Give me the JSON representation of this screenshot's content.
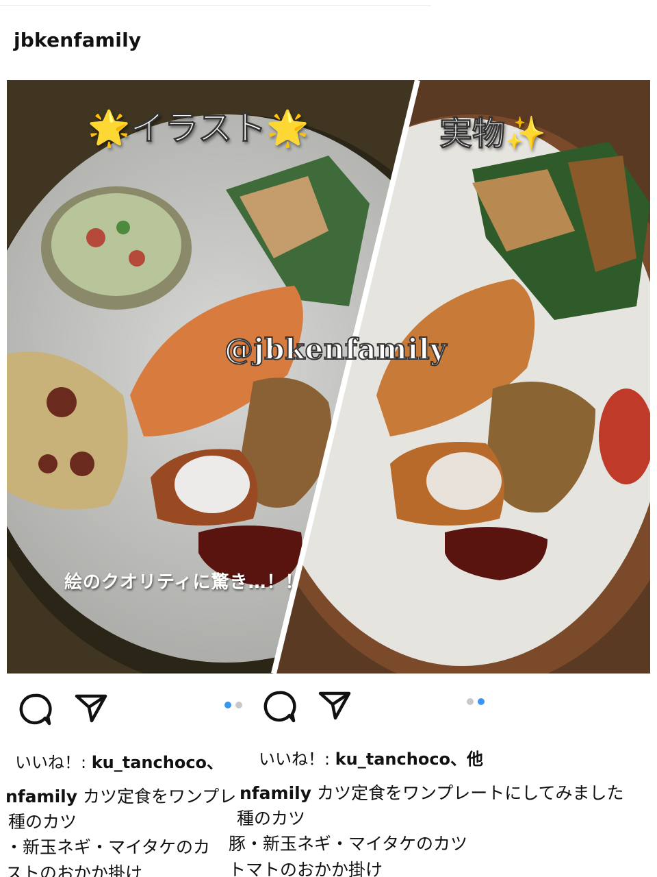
{
  "post": {
    "username": "jbkenfamily",
    "image": {
      "caption_illust": "🌟イラスト🌟",
      "caption_real": "実物✨",
      "watermark": "@jbkenfamily",
      "surprise_text": "絵のクオリティに驚き…！！"
    }
  },
  "left_screenshot": {
    "likes_prefix": "いいね！: ",
    "likes_user": "ku_tanchoco、",
    "caption_user": "nfamily",
    "caption_line1": " カツ定食をワンプレ",
    "caption_line2": "種のカツ",
    "caption_line3": "・新玉ネギ・マイタケのカ",
    "caption_line4": "ストのおかか掛け"
  },
  "right_screenshot": {
    "likes_prefix": "いいね！: ",
    "likes_user": "ku_tanchoco",
    "likes_suffix": "、他",
    "caption_user": "nfamily",
    "caption_line1": " カツ定食をワンプレートにしてみました",
    "caption_line2": "種のカツ",
    "caption_line3": "豚・新玉ネギ・マイタケのカツ",
    "caption_line4": "トマトのおかか掛け"
  },
  "icons": {
    "comment": "comment-icon",
    "share": "share-icon"
  },
  "colors": {
    "carousel_active": "#3897f0",
    "carousel_inactive": "#c8c8c8"
  }
}
